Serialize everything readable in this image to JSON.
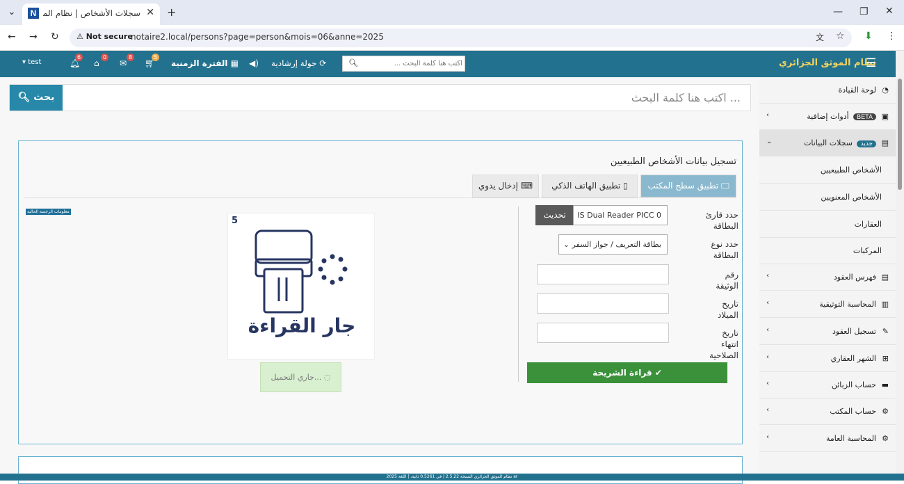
{
  "browser": {
    "tab_title": "سجلات الأشخاص | نظام الموثق ال...",
    "favicon_letter": "N",
    "not_secure": "Not secure",
    "url": "notaire2.local/persons?page=person&mois=06&anne=2025"
  },
  "header": {
    "brand": "نظام الموثق الجزائري",
    "user": "test",
    "badges": {
      "bell": "6",
      "notary": "0",
      "mail": "8",
      "cart": "5"
    },
    "period_label": "الفترة الزمنية",
    "tour_label": "جولة إرشادية",
    "search_placeholder": "اكتب هنا كلمة البحث ..."
  },
  "main_search": {
    "placeholder": "اكتب هنا كلمة البحث ...",
    "button_label": "بحث"
  },
  "panel": {
    "title": "تسجيل بيانات الأشخاص الطبيعيين",
    "tabs": [
      "تطبيق سطح المكتب",
      "تطبيق الهاتف الذكي",
      "إدخال يدوي"
    ],
    "license_tag": "معلومات الرخصة الحالية",
    "reader_label": "حدد قارئ البطاقة",
    "reader_value": "IS Dual Reader PICC 0",
    "refresh_label": "تحديث",
    "card_type_label": "حدد نوع البطاقة",
    "card_type_value": "بطاقة التعريف / جواز السفر",
    "doc_number_label": "رقم الوثيقة",
    "birth_date_label": "تاريخ الميلاد",
    "expiry_label": "تاريخ انتهاء الصلاحية",
    "read_button": "قراءة الشريحة",
    "counter": "5",
    "reading_text": "جار القراءة",
    "loading_text": "جاري التحميل..."
  },
  "sidebar": {
    "items": [
      {
        "label": "لوحة القيادة",
        "icon": "dashboard-icon"
      },
      {
        "label": "أدوات إضافية",
        "tag": "BETA",
        "icon": "tools-icon"
      },
      {
        "label": "سجلات البيانات",
        "tag": "جديد",
        "icon": "records-icon"
      },
      {
        "label": "الأشخاص الطبيعيين"
      },
      {
        "label": "الأشخاص المعنويين"
      },
      {
        "label": "العقارات"
      },
      {
        "label": "المركبات"
      },
      {
        "label": "فهرس العقود",
        "icon": "contracts-index-icon"
      },
      {
        "label": "المحاسبة التوثيقية",
        "icon": "chart-icon"
      },
      {
        "label": "تسجيل العقود",
        "icon": "edit-icon"
      },
      {
        "label": "الشهر العقاري",
        "icon": "sitemap-icon"
      },
      {
        "label": "حساب الزبائن",
        "icon": "card-icon"
      },
      {
        "label": "حساب المكتب",
        "icon": "cogs-icon"
      },
      {
        "label": "المحاسبة العامة",
        "icon": "cogs-icon"
      }
    ]
  },
  "footer": "2025 نظام الموثق الجزائري النسخة 2.5.22 | في 0.5261 ثانية، | اللغة ar"
}
